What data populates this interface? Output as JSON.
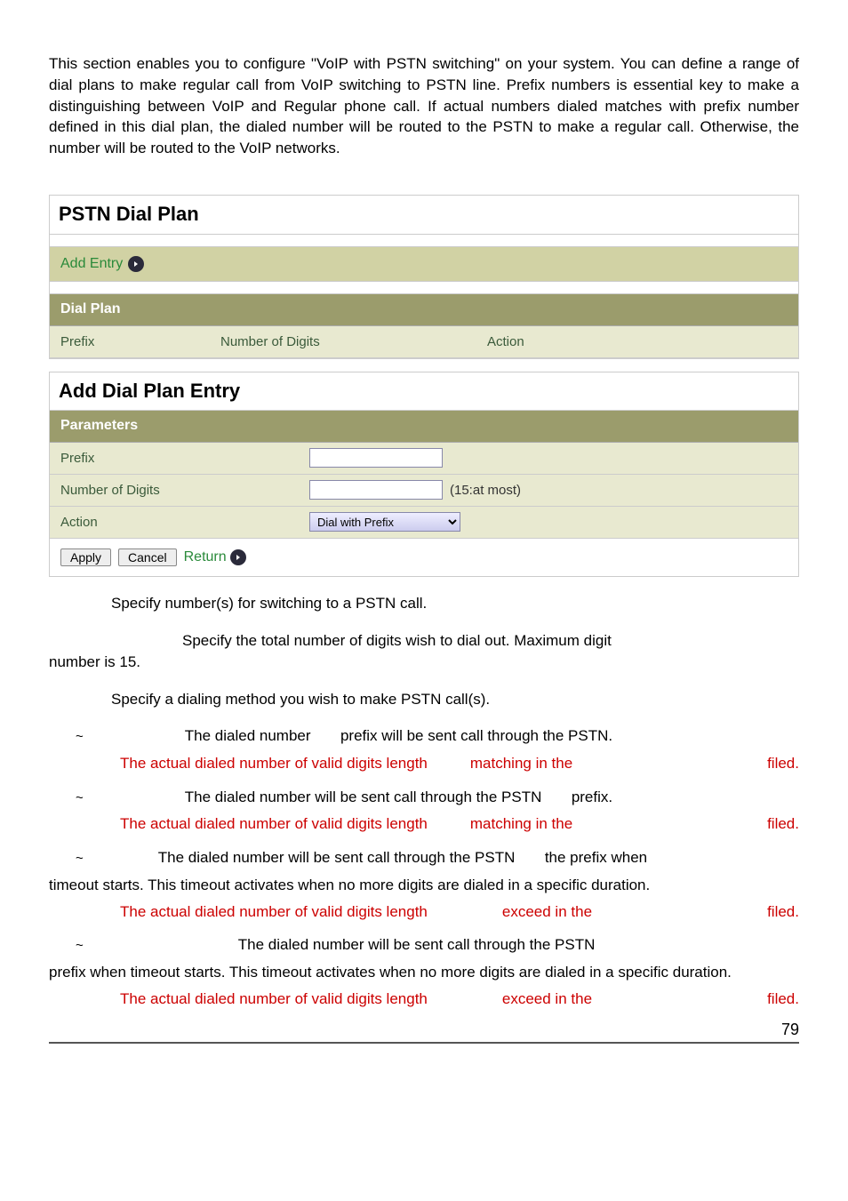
{
  "intro": "This section enables you to configure \"VoIP with PSTN switching\" on your system. You can define a range of dial plans to make regular call from VoIP switching to PSTN line. Prefix numbers is essential key to make a distinguishing between VoIP and Regular phone call. If actual numbers dialed matches with prefix number defined in this dial plan, the dialed number will be routed to the PSTN to make a regular call. Otherwise, the number will be routed to the VoIP networks.",
  "pstn_panel": {
    "title": "PSTN Dial Plan",
    "add_entry": "Add Entry",
    "dial_plan_header": "Dial Plan",
    "cols": {
      "prefix": "Prefix",
      "number": "Number of Digits",
      "action": "Action"
    }
  },
  "add_panel": {
    "title": "Add Dial Plan Entry",
    "params_header": "Parameters",
    "rows": {
      "prefix": {
        "label": "Prefix",
        "value": ""
      },
      "number": {
        "label": "Number of Digits",
        "value": "",
        "hint": "(15:at most)"
      },
      "action": {
        "label": "Action",
        "selected": "Dial with Prefix"
      }
    },
    "buttons": {
      "apply": "Apply",
      "cancel": "Cancel",
      "return": "Return"
    }
  },
  "desc": {
    "p1": "Specify number(s) for switching to a PSTN call.",
    "p2a": "Specify the total number of digits wish to dial out. Maximum digit",
    "p2b": "number is 15.",
    "p3": "Specify a dialing method you wish to make PSTN call(s)."
  },
  "bullets": [
    {
      "pre": "The dialed number ",
      "post": " prefix will be sent call through the PSTN.",
      "note1": "The actual dialed number of valid digits length ",
      "note2": " matching in the ",
      "note3": " filed."
    },
    {
      "pre": "The dialed number will be sent call through the PSTN ",
      "post": " prefix.",
      "note1": "The actual dialed number of valid digits length ",
      "note2": " matching in the ",
      "note3": " filed."
    },
    {
      "pre": "The dialed number will be sent call through the PSTN ",
      "post": " the prefix when",
      "tail": "timeout starts. This timeout activates when no more digits are dialed in a specific duration.",
      "note1": "The actual dialed number of valid digits length ",
      "note2": " exceed in the ",
      "note3": " filed."
    },
    {
      "pre": "The dialed number will be sent call through the PSTN ",
      "tail": "prefix when timeout starts. This timeout activates when no more digits are dialed in a specific duration.",
      "note1": "The actual dialed number of valid digits length ",
      "note2": " exceed in the ",
      "note3": " filed."
    }
  ],
  "bullet_sym": "~",
  "page_number": "79"
}
